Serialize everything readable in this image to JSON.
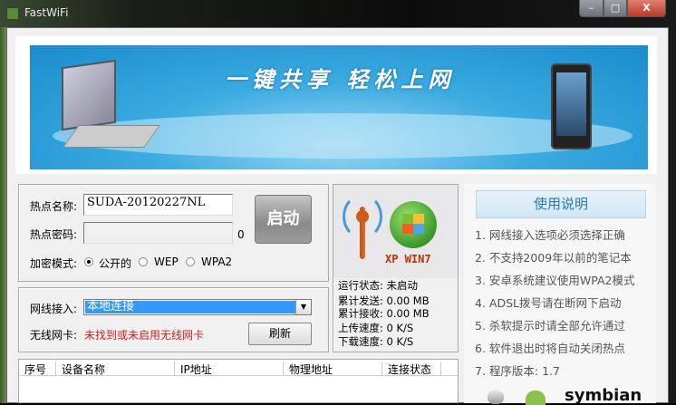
{
  "window": {
    "title": "FastWiFi",
    "minimize": "–",
    "maximize": "□",
    "close": "X"
  },
  "banner": {
    "slogan": "一键共享  轻松上网"
  },
  "hotspot": {
    "name_label": "热点名称:",
    "name_value": "SUDA-20120227NL",
    "password_label": "热点密码:",
    "password_value": "",
    "password_length": "0",
    "start_button": "启动",
    "encryption_label": "加密模式:",
    "encryption_options": [
      {
        "label": "公开的",
        "selected": true
      },
      {
        "label": "WEP",
        "selected": false
      },
      {
        "label": "WPA2",
        "selected": false
      }
    ]
  },
  "network": {
    "wired_label": "网线接入:",
    "wired_value": "本地连接",
    "wireless_label": "无线网卡:",
    "wireless_status": "未找到或未启用无线网卡",
    "wireless_status_color": "#cc2222",
    "refresh_button": "刷新"
  },
  "status": {
    "os_badge": "XP WIN7",
    "rows": [
      {
        "label": "运行状态:",
        "value": "未启动"
      },
      {
        "label": "累计发送:",
        "value": "0.00 MB"
      },
      {
        "label": "累计接收:",
        "value": "0.00 MB"
      },
      {
        "label": "上传速度:",
        "value": "0 K/S"
      },
      {
        "label": "下载速度:",
        "value": "0 K/S"
      }
    ]
  },
  "devices": {
    "columns": [
      "序号",
      "设备名称",
      "IP地址",
      "物理地址",
      "连接状态"
    ],
    "rows": []
  },
  "help": {
    "title": "使用说明",
    "tips": [
      "1. 网线接入选项必须选择正确",
      "2. 不支持2009年以前的笔记本",
      "3. 安卓系统建议使用WPA2模式",
      "4. ADSL拨号请在断网下启动",
      "5. 杀软提示时请全部允许通过",
      "6. 软件退出时将自动关闭热点",
      "7. 程序版本: 1.7"
    ],
    "platform_logos": [
      "apple",
      "android",
      "symbian"
    ],
    "symbian_text": "symbian"
  }
}
